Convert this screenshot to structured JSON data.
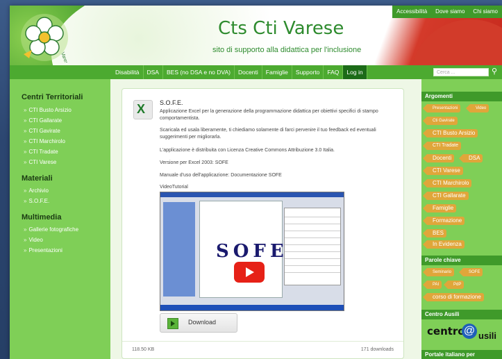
{
  "header": {
    "title": "Cts Cti Varese",
    "subtitle": "sito di supporto alla didattica per l'inclusione",
    "logo_text": "Varese",
    "top_links": [
      "Accessibilità",
      "Dove siamo",
      "Chi siamo"
    ]
  },
  "nav": {
    "items": [
      "Disabilità",
      "DSA",
      "BES (no DSA e no DVA)",
      "Docenti",
      "Famiglie",
      "Supporto",
      "FAQ",
      "Log in"
    ],
    "search_placeholder": "Cerca ..."
  },
  "left_sidebar": {
    "section1_title": "Centri Territoriali",
    "section1_items": [
      "CTI Busto Arsizio",
      "CTI Gallarate",
      "CTI Gavirate",
      "CTI Marchirolo",
      "CTI Tradate",
      "CTI Varese"
    ],
    "section2_title": "Materiali",
    "section2_items": [
      "Archivio",
      "S.O.F.E."
    ],
    "section3_title": "Multimedia",
    "section3_items": [
      "Gallerie fotografiche",
      "Video",
      "Presentazioni"
    ]
  },
  "article": {
    "title": "S.O.F.E.",
    "desc": "Applicazione Excel per la generazione della programmazione didattica per obiettivi specifici di stampo comportamentista.",
    "p1": "Scaricala ed usala liberamente, ti chiediamo solamente di farci pervenire il tuo feedback ed eventuali suggerimenti per migliorarla.",
    "p2": "L'applicazione è distribuita con Licenza Creative Commons Attribuzione 3.0 Italia.",
    "p3": "Versione per Excel 2003: SOFE",
    "p4": "Manuale d'uso dell'applicazione: Documentazione SOFE",
    "video_label": "VideoTutorial",
    "video_overlay": "SOFE",
    "download_label": "Download",
    "file_size": "118.50 KB",
    "downloads": "171 downloads"
  },
  "right_sidebar": {
    "argomenti_title": "Argomenti",
    "argomenti_tags": [
      "Presentazioni",
      "Video",
      "Cti Gavirate",
      "CTI Busto Arsizio",
      "CTI Tradate",
      "Docenti",
      "DSA",
      "CTI Varese",
      "CTI Marchirolo",
      "CTI Gallarate",
      "Famiglie",
      "Formazione",
      "BES",
      "In Evidenza"
    ],
    "parole_title": "Parole chiave",
    "parole_tags": [
      "Seminario",
      "SOFE",
      "PAI",
      "PdP",
      "corso di formazione"
    ],
    "ausili_title": "Centro Ausili",
    "ausili_logo": {
      "a": "centro",
      "b": "@",
      "c": "usili"
    },
    "portale_title": "Portale italiano per"
  },
  "colors": {
    "green_dark": "#3f9a2a",
    "green_light": "#7fcf57",
    "tag_orange": "#e0a63a",
    "title_green": "#2e8b2e"
  }
}
